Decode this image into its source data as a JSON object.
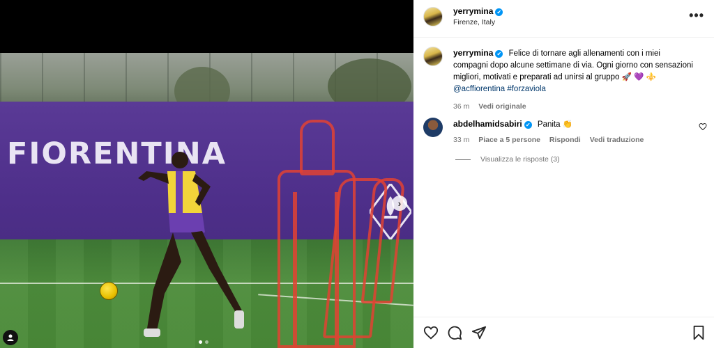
{
  "post": {
    "author": "yerrymina",
    "location": "Firenze, Italy",
    "more_label": "•••",
    "verified_mark": "✔"
  },
  "media": {
    "banner_text": "FIORENTINA",
    "carousel": {
      "count": 2,
      "active": 1
    },
    "next_label": "›"
  },
  "caption": {
    "author": "yerrymina",
    "text": "Felice di tornare agli allenamenti con i miei compagni dopo alcune settimane di via. Ogni giorno con sensazioni migliori, motivati e preparati ad unirsi al gruppo 🚀 💜 ⚜️",
    "mention": "@acffiorentina",
    "hashtag": "#forzaviola",
    "time": "36 m",
    "see_original": "Vedi originale"
  },
  "comments": [
    {
      "author": "abdelhamidsabiri",
      "text": "Panita 👏",
      "time": "33 m",
      "likes": "Piace a 5 persone",
      "reply": "Rispondi",
      "translate": "Vedi traduzione",
      "view_replies": "Visualizza le risposte (3)"
    }
  ],
  "icons": {
    "like": "heart-icon",
    "comment": "comment-icon",
    "share": "share-icon",
    "save": "bookmark-icon"
  },
  "colors": {
    "verified": "#0095f6",
    "fiorentina_purple": "#4e2f8a",
    "link": "#00376b",
    "secondary_text": "#737373"
  }
}
